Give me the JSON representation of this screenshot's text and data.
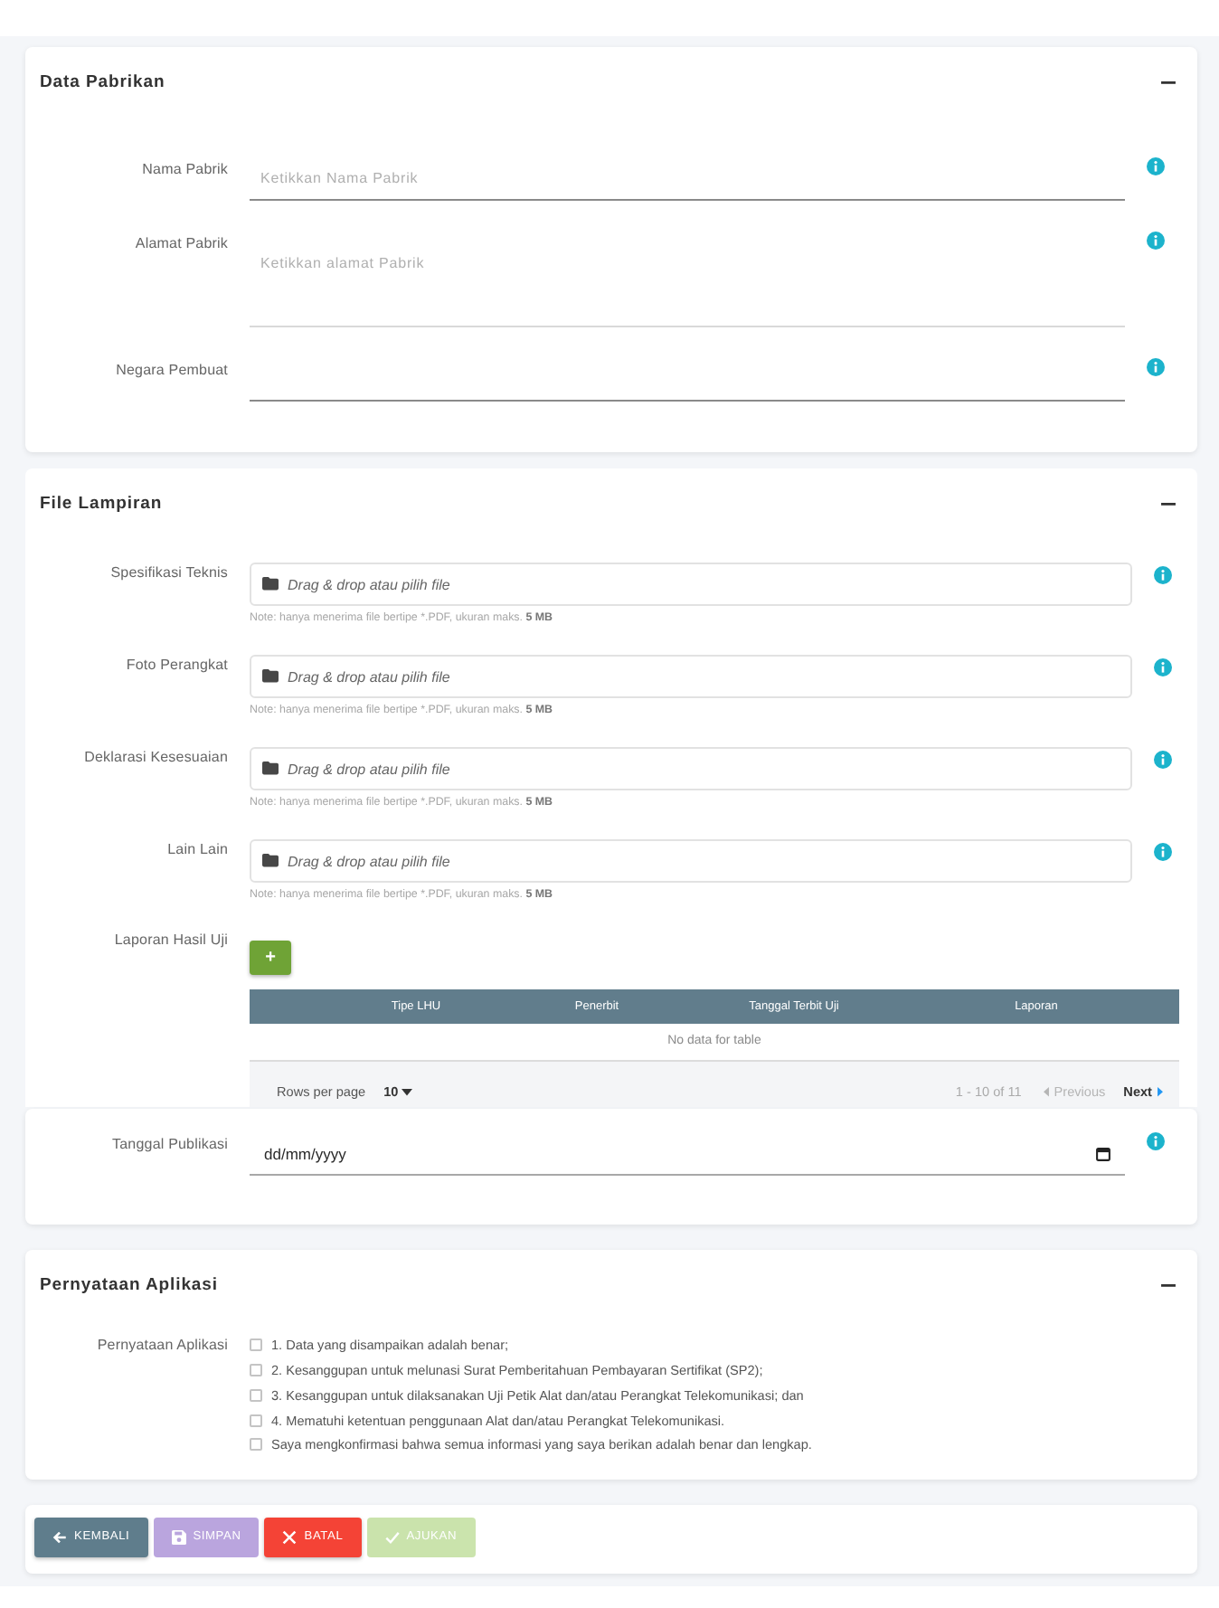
{
  "sections": [
    {
      "kind": "fields",
      "title": "Data Pabrikan",
      "expanded": true,
      "fields": [
        {
          "kind": "text",
          "label": "Nama Pabrik",
          "placeholder": "Ketikkan Nama Pabrik"
        },
        {
          "kind": "textarea",
          "label": "Alamat Pabrik",
          "placeholder": "Ketikkan alamat Pabrik"
        },
        {
          "kind": "text",
          "label": "Negara Pembuat"
        }
      ]
    },
    {
      "kind": "uploads",
      "title": "File Lampiran",
      "expanded": true,
      "uploads": [
        {
          "label": "Spesifikasi Teknis",
          "prompt": "Drag & drop atau pilih file",
          "note": "Note: hanya menerima file bertipe *.PDF, ukuran maks.",
          "limit": "5 MB"
        },
        {
          "label": "Foto Perangkat",
          "prompt": "Drag & drop atau pilih file",
          "note": "Note: hanya menerima file bertipe *.PDF, ukuran maks.",
          "limit": "5 MB"
        },
        {
          "label": "Deklarasi Kesesuaian",
          "prompt": "Drag & drop atau pilih file",
          "note": "Note: hanya menerima file bertipe *.PDF, ukuran maks.",
          "limit": "5 MB"
        },
        {
          "label": "Lain Lain",
          "prompt": "Drag & drop atau pilih file",
          "note": "Note: hanya menerima file bertipe *.PDF, ukuran maks.",
          "limit": "5 MB"
        }
      ],
      "report": {
        "label": "Laporan Hasil Uji",
        "add_button": "+",
        "columns": [
          "Tipe LHU",
          "Penerbit",
          "Tanggal Terbit Uji",
          "Laporan"
        ],
        "empty_text": "No data for table",
        "pagination": {
          "rows_label": "Rows per page",
          "rows_value": "10",
          "range": "1 - 10 of 11",
          "previous": {
            "label": "Previous",
            "disabled": true
          },
          "next": {
            "label": "Next",
            "disabled": false
          }
        }
      }
    },
    {
      "kind": "fields",
      "fields": [
        {
          "kind": "date",
          "label": "Tanggal Publikasi",
          "placeholder": "dd/mm/yyyy"
        }
      ]
    },
    {
      "kind": "statements",
      "title": "Pernyataan Aplikasi",
      "expanded": true,
      "label": "Pernyataan Aplikasi",
      "options": [
        {
          "text": "1. Data yang disampaikan adalah benar;",
          "checked": false
        },
        {
          "text": "2. Kesanggupan untuk melunasi Surat Pemberitahuan Pembayaran Sertifikat (SP2);",
          "checked": false
        },
        {
          "text": "3. Kesanggupan untuk dilaksanakan Uji Petik Alat dan/atau Perangkat Telekomunikasi; dan",
          "checked": false
        },
        {
          "text": "4. Mematuhi ketentuan penggunaan Alat dan/atau Perangkat Telekomunikasi.",
          "checked": false
        },
        {
          "text": "Saya mengkonfirmasi bahwa semua informasi yang saya berikan adalah benar dan lengkap.",
          "checked": false
        }
      ]
    }
  ],
  "actions": [
    {
      "kind": "back",
      "label": "KEMBALI",
      "disabled": false
    },
    {
      "kind": "save",
      "label": "SIMPAN",
      "disabled": true
    },
    {
      "kind": "cancel",
      "label": "BATAL",
      "disabled": false
    },
    {
      "kind": "submit",
      "label": "AJUKAN",
      "disabled": true
    }
  ]
}
